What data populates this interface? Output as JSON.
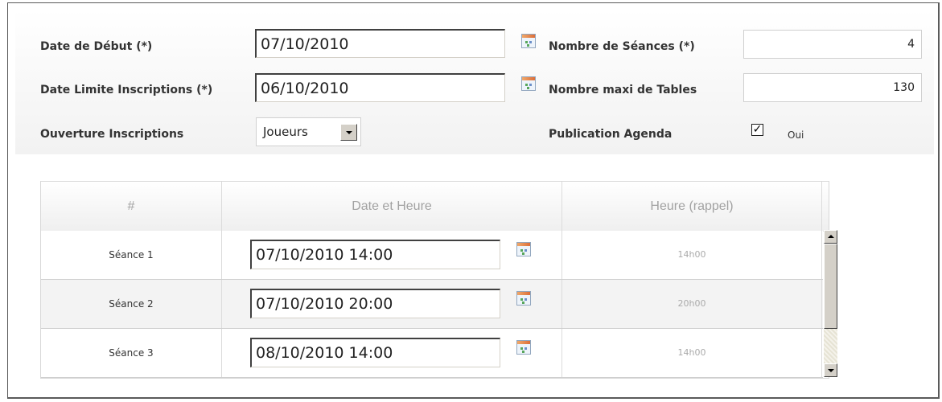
{
  "form": {
    "date_debut_label": "Date de Début (*)",
    "date_debut_value": "07/10/2010",
    "date_limite_label": "Date Limite Inscriptions (*)",
    "date_limite_value": "06/10/2010",
    "ouverture_label": "Ouverture Inscriptions",
    "ouverture_value": "Joueurs",
    "nb_seances_label": "Nombre de Séances (*)",
    "nb_seances_value": "4",
    "nb_tables_label": "Nombre maxi de Tables",
    "nb_tables_value": "130",
    "publication_label": "Publication Agenda",
    "publication_checked": true,
    "publication_check_mark": "✓",
    "publication_option": "Oui"
  },
  "icons": {
    "calendar": "calendar-icon",
    "dropdown": "chevron-down-icon",
    "scroll_up": "arrow-up-icon",
    "scroll_down": "arrow-down-icon"
  },
  "table": {
    "headers": [
      "#",
      "Date et Heure",
      "Heure (rappel)"
    ],
    "rows": [
      {
        "name": "Séance 1",
        "datetime": "07/10/2010 14:00",
        "reminder": "14h00"
      },
      {
        "name": "Séance 2",
        "datetime": "07/10/2010 20:00",
        "reminder": "20h00"
      },
      {
        "name": "Séance 3",
        "datetime": "08/10/2010 14:00",
        "reminder": "14h00"
      }
    ]
  },
  "colors": {
    "label_text": "#333333",
    "header_text": "#a2a2a2",
    "row_alt_bg": "#f3f3f3"
  }
}
